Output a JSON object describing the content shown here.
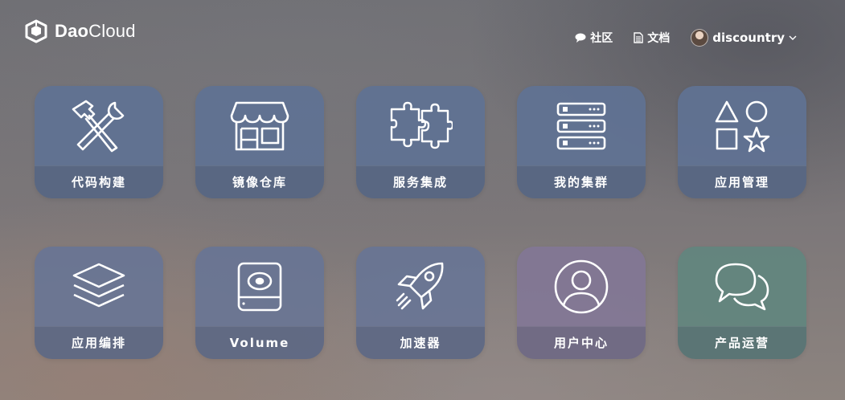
{
  "brand": {
    "logo_icon": "daocloud-cube-icon",
    "name_bold": "Dao",
    "name_light": "Cloud"
  },
  "nav": {
    "community": "社区",
    "docs": "文档",
    "user": "discountry"
  },
  "tiles": [
    {
      "label": "代码构建",
      "icon": "tools-icon",
      "color": "#607294"
    },
    {
      "label": "镜像仓库",
      "icon": "store-icon",
      "color": "#607294"
    },
    {
      "label": "服务集成",
      "icon": "puzzle-icon",
      "color": "#607294"
    },
    {
      "label": "我的集群",
      "icon": "server-icon",
      "color": "#607294"
    },
    {
      "label": "应用管理",
      "icon": "shapes-icon",
      "color": "#607294"
    },
    {
      "label": "应用编排",
      "icon": "layers-icon",
      "color": "#667496"
    },
    {
      "label": "Volume",
      "icon": "disk-icon",
      "color": "#667496"
    },
    {
      "label": "加速器",
      "icon": "rocket-icon",
      "color": "#667496"
    },
    {
      "label": "用户中心",
      "icon": "user-icon",
      "color": "#827696"
    },
    {
      "label": "产品运营",
      "icon": "chat-icon",
      "color": "#62867e"
    }
  ]
}
